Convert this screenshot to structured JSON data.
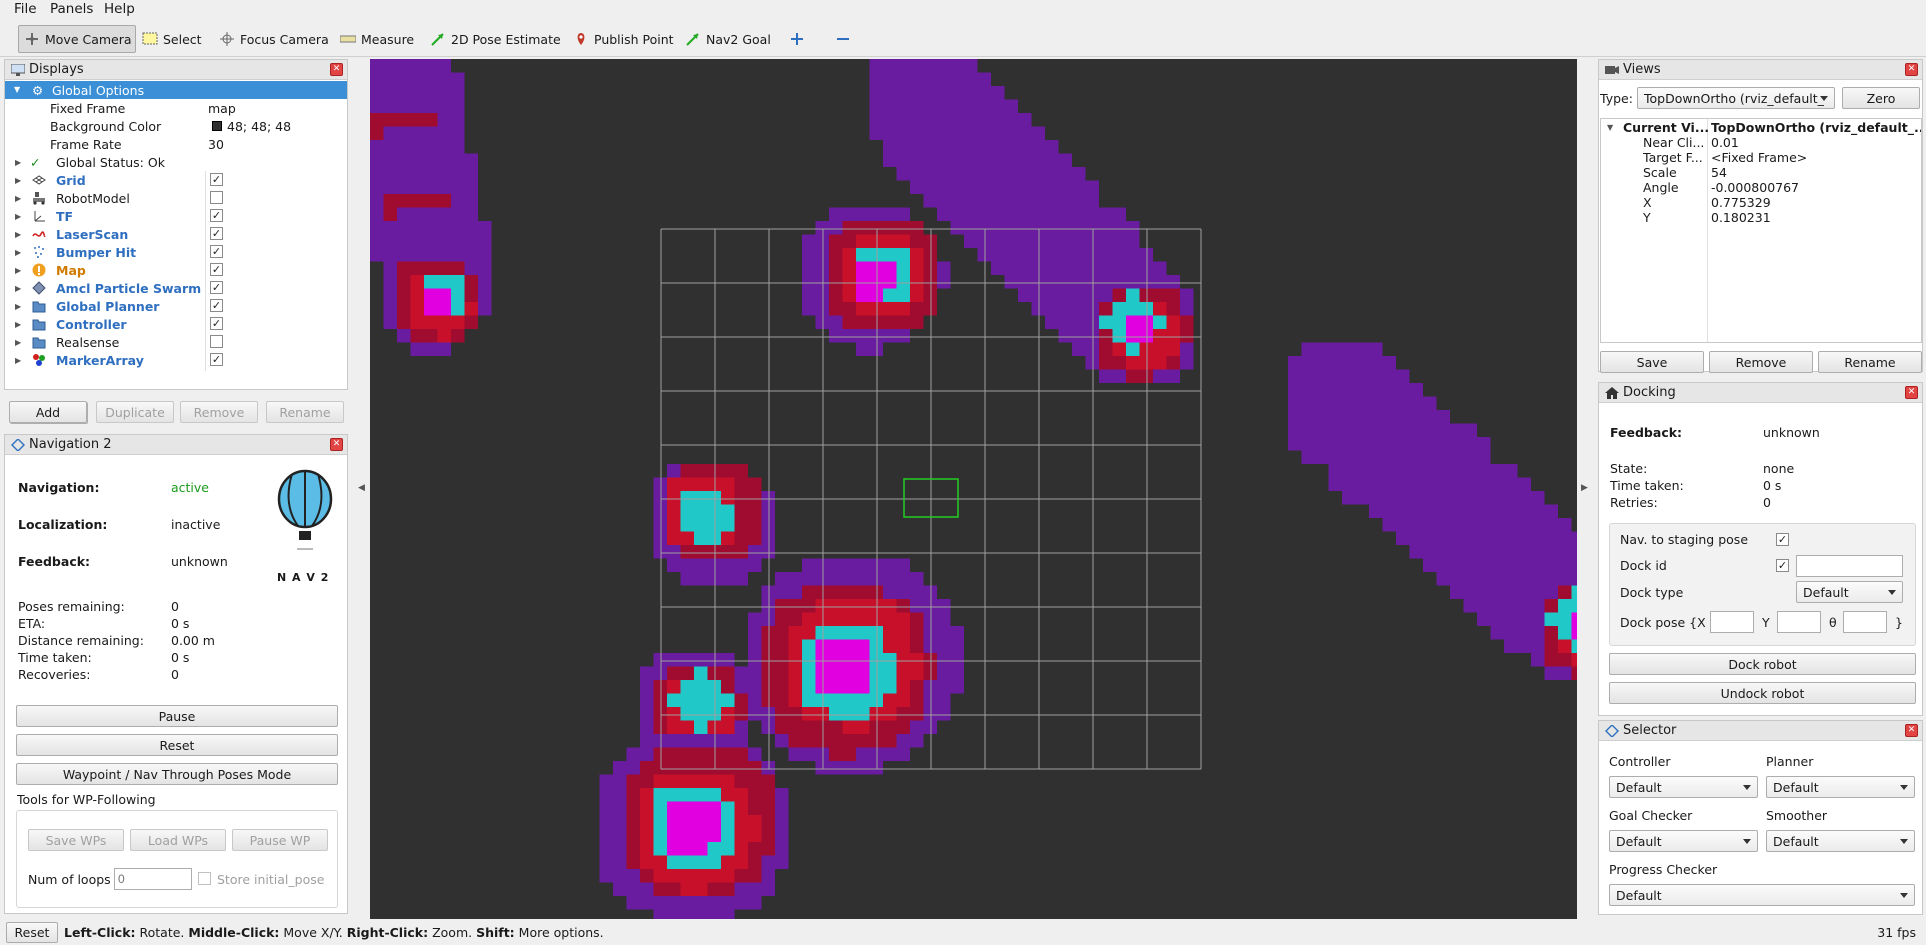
{
  "menus": [
    "File",
    "Panels",
    "Help"
  ],
  "toolbar": {
    "tools": [
      "Move Camera",
      "Select",
      "Focus Camera",
      "Measure",
      "2D Pose Estimate",
      "Publish Point",
      "Nav2 Goal"
    ],
    "active_tool": "Move Camera",
    "extra_icons": [
      "plus-icon",
      "minus-icon"
    ]
  },
  "displays": {
    "title": "Displays",
    "global_options": {
      "label": "Global Options",
      "fixed_frame_label": "Fixed Frame",
      "fixed_frame": "map",
      "background_color_label": "Background Color",
      "background_color": "48; 48; 48",
      "background_swatch": "#303030",
      "frame_rate_label": "Frame Rate",
      "frame_rate": "30"
    },
    "global_status": "Global Status: Ok",
    "items": [
      {
        "label": "Grid",
        "checked": true,
        "style": "blue",
        "icon": "grid-icon"
      },
      {
        "label": "RobotModel",
        "checked": false,
        "style": "plain",
        "icon": "robot-model-icon"
      },
      {
        "label": "TF",
        "checked": true,
        "style": "blue",
        "icon": "tf-icon"
      },
      {
        "label": "LaserScan",
        "checked": true,
        "style": "blue",
        "icon": "laserscan-icon"
      },
      {
        "label": "Bumper Hit",
        "checked": true,
        "style": "blue",
        "icon": "bumper-icon"
      },
      {
        "label": "Map",
        "checked": true,
        "style": "orange",
        "icon": "warning-icon"
      },
      {
        "label": "Amcl Particle Swarm",
        "checked": true,
        "style": "blue",
        "icon": "particle-icon"
      },
      {
        "label": "Global Planner",
        "checked": true,
        "style": "blue",
        "icon": "folder-icon"
      },
      {
        "label": "Controller",
        "checked": true,
        "style": "blue",
        "icon": "folder-icon"
      },
      {
        "label": "Realsense",
        "checked": false,
        "style": "plain",
        "icon": "folder-icon"
      },
      {
        "label": "MarkerArray",
        "checked": true,
        "style": "blue",
        "icon": "marker-icon"
      }
    ],
    "buttons": {
      "add": "Add",
      "duplicate": "Duplicate",
      "remove": "Remove",
      "rename": "Rename"
    }
  },
  "nav2": {
    "title": "Navigation 2",
    "navigation_label": "Navigation:",
    "navigation_value": "active",
    "localization_label": "Localization:",
    "localization_value": "inactive",
    "feedback_label": "Feedback:",
    "feedback_value": "unknown",
    "logo_text": "N A V 2",
    "stats": [
      {
        "label": "Poses remaining:",
        "value": "0"
      },
      {
        "label": "ETA:",
        "value": "0 s"
      },
      {
        "label": "Distance remaining:",
        "value": "0.00 m"
      },
      {
        "label": "Time taken:",
        "value": "0 s"
      },
      {
        "label": "Recoveries:",
        "value": "0"
      }
    ],
    "pause_button": "Pause",
    "reset_button": "Reset",
    "waypoint_button": "Waypoint / Nav Through Poses Mode",
    "wp_tools_label": "Tools for WP-Following",
    "save_wps": "Save WPs",
    "load_wps": "Load WPs",
    "pause_wp": "Pause WP",
    "num_loops_label": "Num of loops",
    "num_loops_placeholder": "0",
    "store_initial_pose": "Store initial_pose"
  },
  "views": {
    "title": "Views",
    "type_label": "Type:",
    "type_value": "TopDownOrtho (rviz_default_",
    "zero_button": "Zero",
    "current_view_label": "Current Vi...",
    "current_view_value": "TopDownOrtho (rviz_default_...",
    "props": [
      {
        "label": "Near Cli...",
        "value": "0.01"
      },
      {
        "label": "Target F...",
        "value": "<Fixed Frame>"
      },
      {
        "label": "Scale",
        "value": "54"
      },
      {
        "label": "Angle",
        "value": "-0.000800767"
      },
      {
        "label": "X",
        "value": "0.775329"
      },
      {
        "label": "Y",
        "value": "0.180231"
      }
    ],
    "save_button": "Save",
    "remove_button": "Remove",
    "rename_button": "Rename"
  },
  "docking": {
    "title": "Docking",
    "feedback_label": "Feedback:",
    "feedback_value": "unknown",
    "state_label": "State:",
    "state_value": "none",
    "time_label": "Time taken:",
    "time_value": "0 s",
    "retries_label": "Retries:",
    "retries_value": "0",
    "staging_label": "Nav. to staging pose",
    "staging_checked": true,
    "dock_id_label": "Dock id",
    "dock_id_checked": true,
    "dock_type_label": "Dock type",
    "dock_type_value": "Default",
    "dock_pose_label": "Dock pose {X",
    "y_label": "Y",
    "theta_label": "θ",
    "close_brace": "}",
    "dock_button": "Dock robot",
    "undock_button": "Undock robot"
  },
  "selector": {
    "title": "Selector",
    "controller_label": "Controller",
    "controller_value": "Default",
    "planner_label": "Planner",
    "planner_value": "Default",
    "goal_checker_label": "Goal Checker",
    "goal_checker_value": "Default",
    "smoother_label": "Smoother",
    "smoother_value": "Default",
    "progress_checker_label": "Progress Checker",
    "progress_checker_value": "Default"
  },
  "status": {
    "reset_button": "Reset",
    "hint_parts": [
      {
        "b": "Left-Click:",
        "t": " Rotate. "
      },
      {
        "b": "Middle-Click:",
        "t": " Move X/Y. "
      },
      {
        "b": "Right-Click:",
        "t": " Zoom. "
      },
      {
        "b": "Shift:",
        "t": " More options."
      }
    ],
    "fps": "31 fps"
  },
  "colors": {
    "cyan": "#20c8c8",
    "magenta": "#e000e0",
    "dark_red": "#a00c30",
    "red": "#c8102a",
    "purple": "#6a1ca0",
    "background": "#303030",
    "grid": "#a0a0a0",
    "robot": "#22cc22",
    "highlight": "#3a8fd6"
  }
}
